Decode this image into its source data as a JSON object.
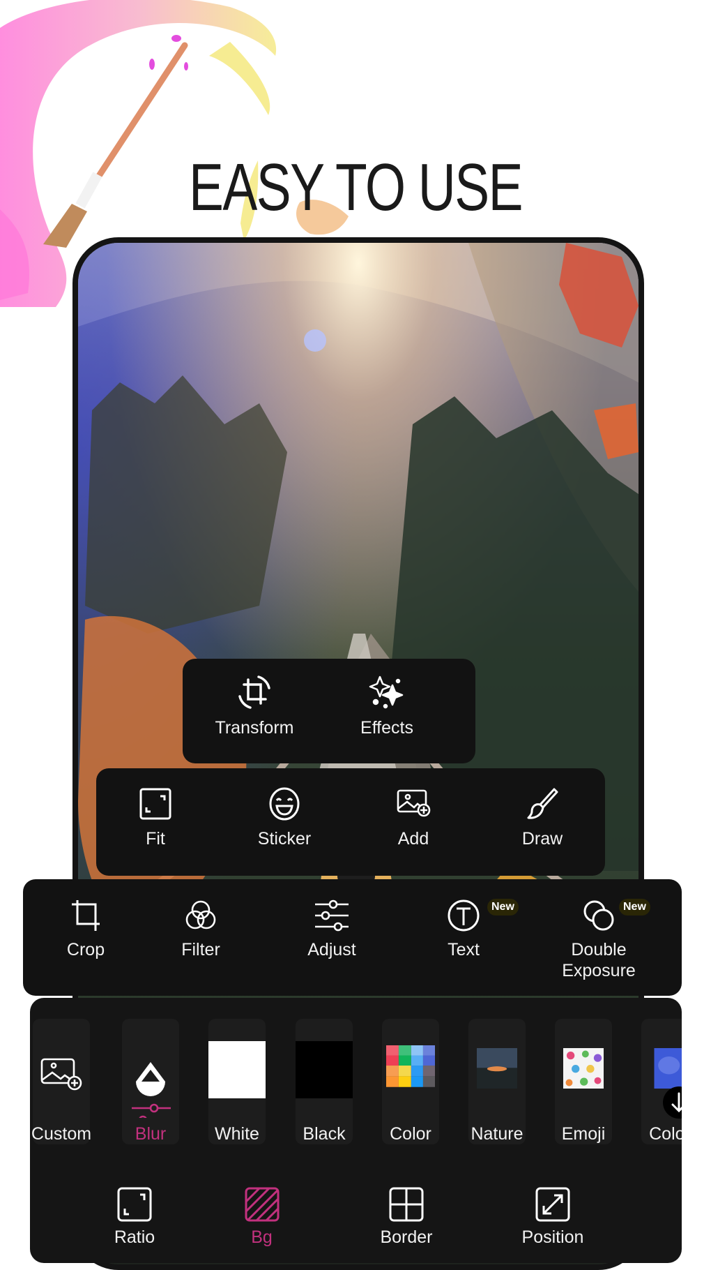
{
  "headline": "EASY TO USE",
  "colors": {
    "accent": "#c2317e",
    "panel": "#121212",
    "item_bg": "#1d1d1d",
    "badge_bg": "#2a2606"
  },
  "panel_transform": {
    "items": [
      {
        "label": "Transform",
        "icon": "transform-icon"
      },
      {
        "label": "Effects",
        "icon": "sparkles-icon"
      }
    ]
  },
  "panel_tools": {
    "items": [
      {
        "label": "Fit",
        "icon": "fit-icon"
      },
      {
        "label": "Sticker",
        "icon": "smiley-icon"
      },
      {
        "label": "Add",
        "icon": "add-image-icon"
      },
      {
        "label": "Draw",
        "icon": "brush-icon"
      }
    ]
  },
  "panel_edit": {
    "items": [
      {
        "label": "Crop",
        "icon": "crop-icon"
      },
      {
        "label": "Filter",
        "icon": "filter-circles-icon"
      },
      {
        "label": "Adjust",
        "icon": "sliders-icon"
      },
      {
        "label": "Text",
        "icon": "text-circle-icon",
        "badge": "New"
      },
      {
        "label": "Double\nExposure",
        "label_line1": "Double",
        "label_line2": "Exposure",
        "icon": "double-circles-icon",
        "badge": "New"
      }
    ]
  },
  "panel_bg": {
    "backgrounds": [
      {
        "label": "Custom",
        "icon": "add-image-icon"
      },
      {
        "label": "Blur",
        "icon": "blur-drop-icon",
        "selected": true
      },
      {
        "label": "White",
        "swatch": "#ffffff"
      },
      {
        "label": "Black",
        "swatch": "#000000"
      },
      {
        "label": "Color",
        "icon": "color-grid-icon"
      },
      {
        "label": "Nature",
        "icon": "nature-thumb"
      },
      {
        "label": "Emoji",
        "icon": "emoji-pattern-thumb"
      },
      {
        "label": "Color",
        "icon": "watercolor-thumb"
      }
    ],
    "scroll_button": "download-arrow-icon",
    "bottom_tabs": [
      {
        "label": "Ratio",
        "icon": "ratio-icon"
      },
      {
        "label": "Bg",
        "icon": "bg-hatch-icon",
        "active": true
      },
      {
        "label": "Border",
        "icon": "border-grid-icon"
      },
      {
        "label": "Position",
        "icon": "position-arrows-icon"
      }
    ]
  }
}
